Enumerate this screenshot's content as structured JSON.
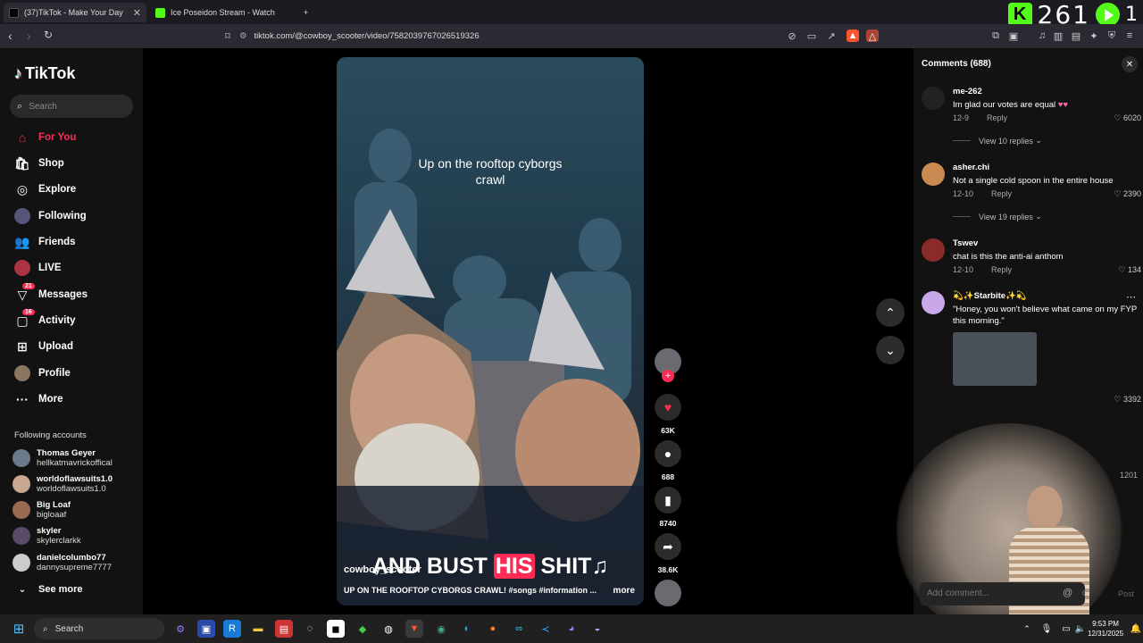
{
  "browser": {
    "tabs": [
      {
        "title": "(37)TikTok - Make Your Day",
        "active": true
      },
      {
        "title": "Ice Poseidon Stream - Watch Live",
        "active": false
      }
    ],
    "url": "tiktok.com/@cowboy_scooter/video/7582039767026519326",
    "overlay_count": "261"
  },
  "sidebar": {
    "brand": "TikTok",
    "search_placeholder": "Search",
    "nav": [
      {
        "label": "For You",
        "icon": "home-icon"
      },
      {
        "label": "Shop",
        "icon": "shop-icon"
      },
      {
        "label": "Explore",
        "icon": "compass-icon"
      },
      {
        "label": "Following",
        "icon": "following-icon"
      },
      {
        "label": "Friends",
        "icon": "friends-icon"
      },
      {
        "label": "LIVE",
        "icon": "live-icon"
      },
      {
        "label": "Messages",
        "icon": "messages-icon",
        "badge": "21"
      },
      {
        "label": "Activity",
        "icon": "activity-icon",
        "badge": "16"
      },
      {
        "label": "Upload",
        "icon": "upload-icon"
      },
      {
        "label": "Profile",
        "icon": "profile-icon"
      },
      {
        "label": "More",
        "icon": "more-icon"
      }
    ],
    "following_title": "Following accounts",
    "accounts": [
      {
        "name": "Thomas Geyer",
        "handle": "hellkatmavrickoffical"
      },
      {
        "name": "worldoflawsuits1.0",
        "handle": "worldoflawsuits1.0"
      },
      {
        "name": "Big Loaf",
        "handle": "bigloaaf"
      },
      {
        "name": "skyler",
        "handle": "skylerclarkk"
      },
      {
        "name": "danielcolumbo77",
        "handle": "dannysupreme7777"
      }
    ],
    "see_more": "See more"
  },
  "video": {
    "caption_top": "Up on the rooftop cyborgs crawl",
    "lyric_pre": "AND BUST ",
    "lyric_hl": "HIS",
    "lyric_post": " SHIT",
    "author": "cowboy_scooter",
    "description": "UP ON THE ROOFTOP CYBORGS CRAWL! #songs #information ...",
    "more": "more"
  },
  "actions": {
    "likes": "63K",
    "comments": "688",
    "saves": "8740",
    "shares": "38.6K"
  },
  "comments_panel": {
    "title": "Comments (688)",
    "items": [
      {
        "user": "me-262",
        "text": "Im glad our votes are equal",
        "date": "12-9",
        "reply": "Reply",
        "likes": "6020",
        "view_replies": "View 10 replies"
      },
      {
        "user": "asher.chi",
        "text": "Not a single cold spoon in the entire house",
        "date": "12-10",
        "reply": "Reply",
        "likes": "2390",
        "view_replies": "View 19 replies"
      },
      {
        "user": "Tswev",
        "text": "chat is this the anti-ai anthom",
        "date": "12-10",
        "reply": "Reply",
        "likes": "134"
      },
      {
        "user": "Starbite",
        "text": "\"Honey, you won't believe what came on my FYP this morning.\"",
        "likes": "3392"
      }
    ],
    "hidden_likes": "1201",
    "add_placeholder": "Add comment...",
    "post": "Post"
  },
  "taskbar": {
    "search": "Search",
    "time": "9:53 PM",
    "date": "12/31/2025"
  },
  "colors": {
    "accent": "#fe2c55",
    "kick": "#53fc18"
  }
}
